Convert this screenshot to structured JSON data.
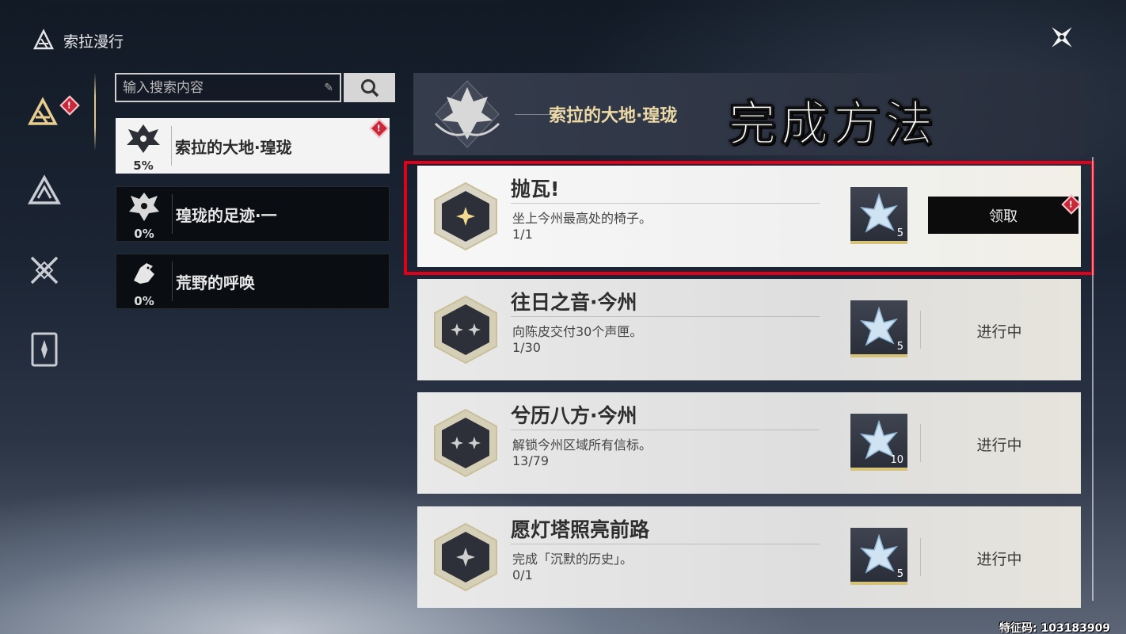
{
  "header": {
    "title": "索拉漫行"
  },
  "search": {
    "placeholder": "输入搜索内容"
  },
  "categories": [
    {
      "name": "索拉的大地·瑝珑",
      "percent": "5%",
      "active": true,
      "alert": true
    },
    {
      "name": "瑝珑的足迹·一",
      "percent": "0%",
      "active": false,
      "alert": false
    },
    {
      "name": "荒野的呼唤",
      "percent": "0%",
      "active": false,
      "alert": false
    }
  ],
  "section": {
    "title": "索拉的大地·瑝珑",
    "overlay_caption": "完成方法"
  },
  "achievements": [
    {
      "name": "抛瓦!",
      "description": "坐上今州最高处的椅子。",
      "progress": "1/1",
      "reward_count": "5",
      "action": "领取",
      "completed": true
    },
    {
      "name": "往日之音·今州",
      "description": "向陈皮交付30个声匣。",
      "progress": "1/30",
      "reward_count": "5",
      "action": "进行中",
      "completed": false
    },
    {
      "name": "兮历八方·今州",
      "description": "解锁今州区域所有信标。",
      "progress": "13/79",
      "reward_count": "10",
      "action": "进行中",
      "completed": false
    },
    {
      "name": "愿灯塔照亮前路",
      "description": "完成「沉默的历史」。",
      "progress": "0/1",
      "reward_count": "5",
      "action": "进行中",
      "completed": false
    }
  ],
  "watermark": "特征码: 103183909",
  "colors": {
    "accent_gold": "#e2c78c",
    "alert_red": "#c8283a",
    "highlight_red": "#e0001a"
  },
  "icons": {
    "nav": [
      "achievement-icon",
      "region-icon",
      "combat-icon",
      "card-icon"
    ],
    "close": "close-icon",
    "search": "search-icon"
  }
}
